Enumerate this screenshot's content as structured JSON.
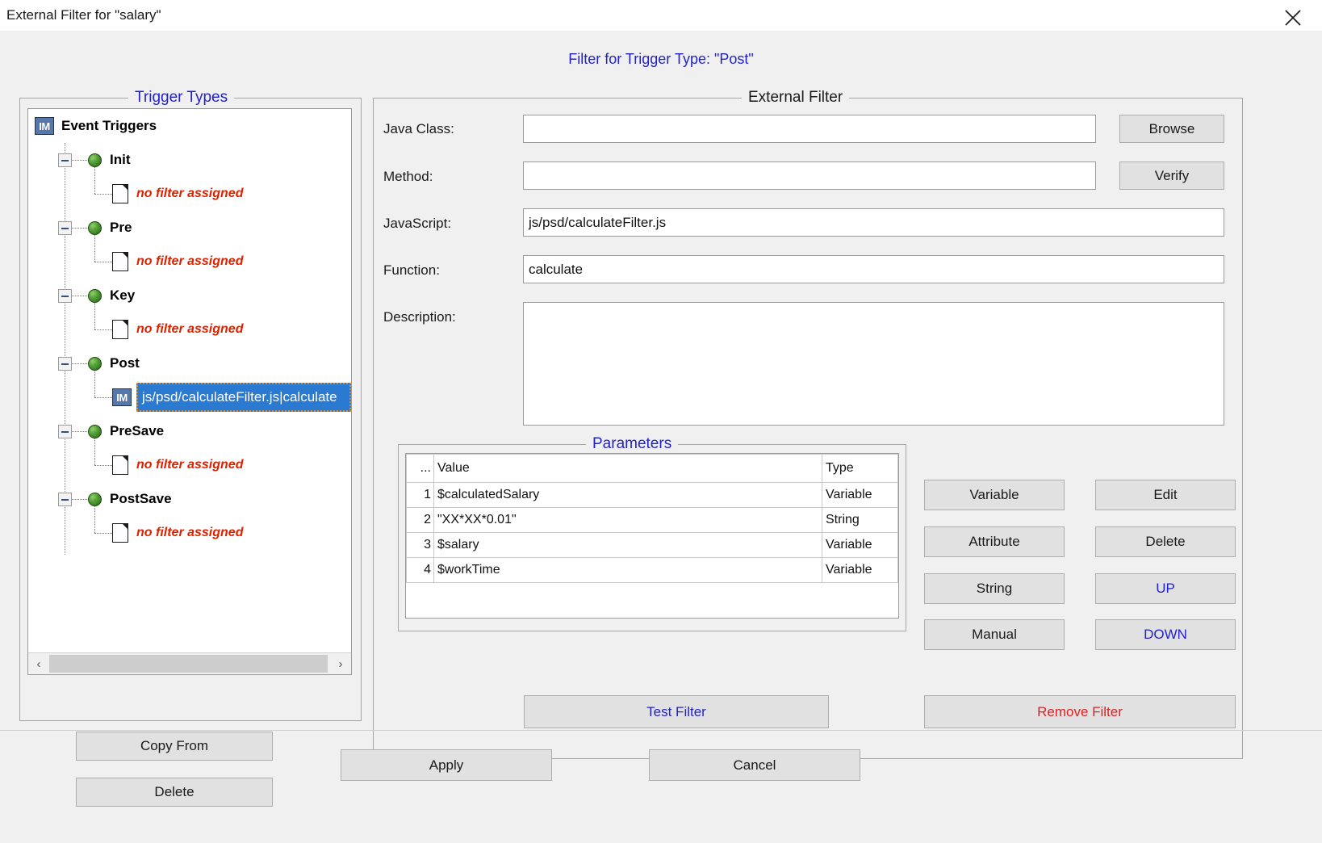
{
  "window": {
    "title": "External Filter for \"salary\"",
    "close_icon": "close-icon"
  },
  "header": {
    "text": "Filter for Trigger Type: \"Post\""
  },
  "colors": {
    "accent_blue": "#2222cc",
    "selection_blue": "#2a7ad1",
    "focus_orange": "#e08a1e",
    "danger_red": "#e02020",
    "nofilter_red": "#dd2200",
    "panel_gray": "#f0f0f0",
    "button_face": "#e1e1e1"
  },
  "trigger_panel": {
    "title": "Trigger Types",
    "tree": {
      "root": {
        "label": "Event Triggers",
        "icon": "im-badge-icon"
      },
      "nodes": [
        {
          "label": "Init",
          "icon": "green-sphere-icon",
          "child": {
            "label": "no filter assigned",
            "icon": "document-icon",
            "selected": false
          }
        },
        {
          "label": "Pre",
          "icon": "green-sphere-icon",
          "child": {
            "label": "no filter assigned",
            "icon": "document-icon",
            "selected": false
          }
        },
        {
          "label": "Key",
          "icon": "green-sphere-icon",
          "child": {
            "label": "no filter assigned",
            "icon": "document-icon",
            "selected": false
          }
        },
        {
          "label": "Post",
          "icon": "green-sphere-icon",
          "child": {
            "label": "js/psd/calculateFilter.js|calculate",
            "icon": "im-badge-icon",
            "selected": true
          }
        },
        {
          "label": "PreSave",
          "icon": "green-sphere-icon",
          "child": {
            "label": "no filter assigned",
            "icon": "document-icon",
            "selected": false
          }
        },
        {
          "label": "PostSave",
          "icon": "green-sphere-icon",
          "child": {
            "label": "no filter assigned",
            "icon": "document-icon",
            "selected": false
          }
        }
      ]
    },
    "scrollbar": {
      "left_arrow": "‹",
      "right_arrow": "›"
    },
    "buttons": {
      "copy_from": "Copy From",
      "delete": "Delete"
    }
  },
  "external_filter": {
    "title": "External Filter",
    "fields": {
      "java_class": {
        "label": "Java Class:",
        "value": "",
        "placeholder": ""
      },
      "method": {
        "label": "Method:",
        "value": "",
        "placeholder": ""
      },
      "javascript": {
        "label": "JavaScript:",
        "value": "js/psd/calculateFilter.js",
        "placeholder": ""
      },
      "function": {
        "label": "Function:",
        "value": "calculate",
        "placeholder": ""
      },
      "description": {
        "label": "Description:",
        "value": "",
        "placeholder": ""
      }
    },
    "buttons": {
      "browse": "Browse",
      "verify": "Verify",
      "test_filter": "Test Filter",
      "remove_filter": "Remove Filter"
    }
  },
  "parameters": {
    "title": "Parameters",
    "columns": [
      "...",
      "Value",
      "Type"
    ],
    "rows": [
      {
        "index": "1",
        "value": "$calculatedSalary",
        "type": "Variable"
      },
      {
        "index": "2",
        "value": "\"XX*XX*0.01\"",
        "type": "String"
      },
      {
        "index": "3",
        "value": "$salary",
        "type": "Variable"
      },
      {
        "index": "4",
        "value": "$workTime",
        "type": "Variable"
      }
    ],
    "buttons": {
      "variable": "Variable",
      "attribute": "Attribute",
      "string": "String",
      "manual": "Manual",
      "edit": "Edit",
      "delete": "Delete",
      "up": "UP",
      "down": "DOWN"
    }
  },
  "footer": {
    "apply": "Apply",
    "cancel": "Cancel"
  }
}
